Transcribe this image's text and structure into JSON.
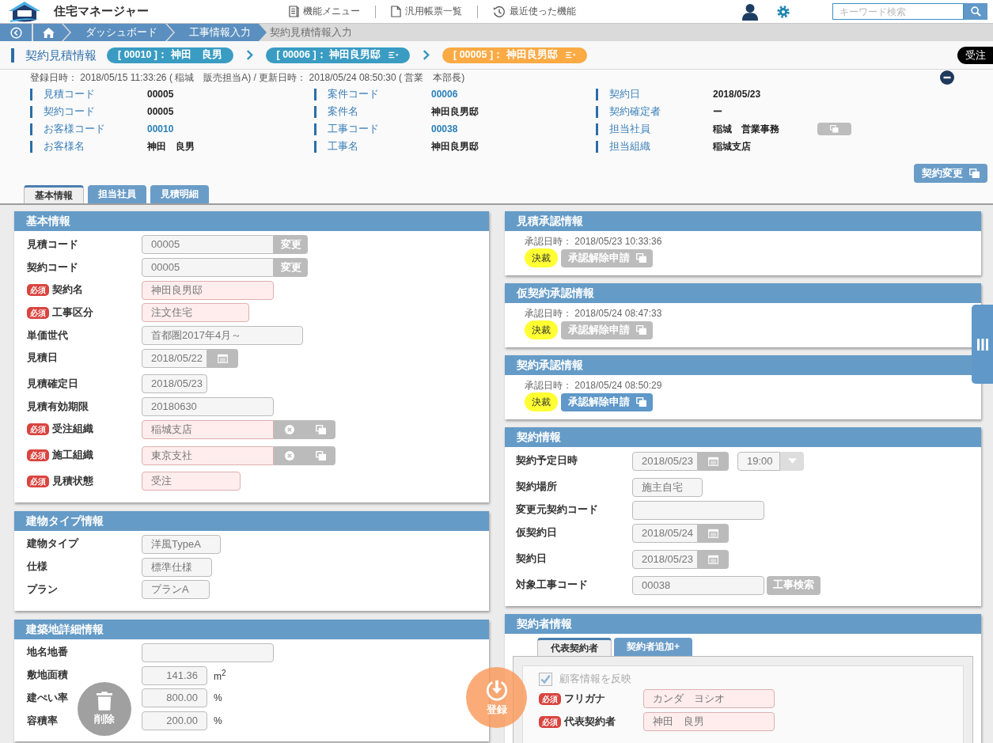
{
  "header": {
    "app_title": "住宅マネージャー",
    "menu": [
      {
        "kind": "functions",
        "label": "機能メニュー"
      },
      {
        "kind": "forms",
        "label": "汎用帳票一覧"
      },
      {
        "kind": "recent",
        "label": "最近使った機能"
      }
    ],
    "search": {
      "placeholder": "キーワード検索"
    }
  },
  "breadcrumb": [
    {
      "kind": "back"
    },
    {
      "kind": "home"
    },
    {
      "kind": "link",
      "label": "ダッシュボード"
    },
    {
      "kind": "link",
      "label": "工事情報入力"
    },
    {
      "kind": "current",
      "label": "契約見積情報入力"
    }
  ],
  "title_bar": {
    "title": "契約見積情報",
    "chips": [
      {
        "label": "[ 00010 ]： 神田　良男",
        "color": "#3a9cc2",
        "menu": false
      },
      {
        "label": "[ 00006 ]： 神田良男邸",
        "color": "#3a9cc2",
        "menu": true
      },
      {
        "label": "[ 00005 ]： 神田良男邸",
        "color": "#fbaa44",
        "menu": true
      }
    ],
    "status_badge": "受注"
  },
  "record_info": {
    "timestamps": "登録日時： 2018/05/15 11:33:26 ( 稲城　販売担当A) / 更新日時： 2018/05/24 08:50:30 ( 営業　本部長)",
    "expanded": true,
    "columns": [
      [
        {
          "label": "見積コード",
          "value": "00005",
          "kind": "text"
        },
        {
          "label": "契約コード",
          "value": "00005",
          "kind": "text"
        },
        {
          "label": "お客様コード",
          "value": "00010",
          "kind": "link"
        },
        {
          "label": "お客様名",
          "value": "神田　良男",
          "kind": "text"
        }
      ],
      [
        {
          "label": "案件コード",
          "value": "00006",
          "kind": "link"
        },
        {
          "label": "案件名",
          "value": "神田良男邸",
          "kind": "text"
        },
        {
          "label": "工事コード",
          "value": "00038",
          "kind": "link"
        },
        {
          "label": "工事名",
          "value": "神田良男邸",
          "kind": "text"
        }
      ],
      [
        {
          "label": "契約日",
          "value": "2018/05/23",
          "kind": "text"
        },
        {
          "label": "契約確定者",
          "value": "ー",
          "kind": "text"
        },
        {
          "label": "担当社員",
          "value": "稲城　営業事務",
          "kind": "text_button"
        },
        {
          "label": "担当組織",
          "value": "稲城支店",
          "kind": "text"
        }
      ]
    ],
    "action_button": "契約変更"
  },
  "tabs": [
    {
      "label": "基本情報",
      "selected": true
    },
    {
      "label": "担当社員",
      "selected": false
    },
    {
      "label": "見積明細",
      "selected": false
    }
  ],
  "basic_panels": [
    {
      "title": "基本情報",
      "rows": [
        {
          "label": "見積コード",
          "required": false,
          "kind": "field_button",
          "value": "00005",
          "button": "変更"
        },
        {
          "label": "契約コード",
          "required": false,
          "kind": "field_button",
          "value": "00005",
          "button": "変更"
        },
        {
          "label": "契約名",
          "required": true,
          "badge": "必須",
          "kind": "field",
          "value": "神田良男邸"
        },
        {
          "label": "工事区分",
          "required": true,
          "badge": "必須",
          "kind": "field",
          "value": "注文住宅"
        },
        {
          "label": "単価世代",
          "required": false,
          "kind": "field",
          "value": "首都圏2017年4月～"
        },
        {
          "label": "見積日",
          "required": false,
          "kind": "date",
          "value": "2018/05/22"
        },
        {
          "label": "見積確定日",
          "required": false,
          "kind": "field",
          "value": "2018/05/23"
        },
        {
          "label": "見積有効期限",
          "required": false,
          "kind": "field",
          "value": "20180630"
        },
        {
          "label": "受注組織",
          "required": true,
          "badge": "必須",
          "kind": "org",
          "value": "稲城支店"
        },
        {
          "label": "施工組織",
          "required": true,
          "badge": "必須",
          "kind": "org",
          "value": "東京支社"
        },
        {
          "label": "見積状態",
          "required": true,
          "badge": "必須",
          "kind": "field",
          "value": "受注"
        }
      ]
    },
    {
      "title": "建物タイプ情報",
      "rows": [
        {
          "label": "建物タイプ",
          "required": false,
          "kind": "field",
          "value": "洋風TypeA"
        },
        {
          "label": "仕様",
          "required": false,
          "kind": "field",
          "value": "標準仕様"
        },
        {
          "label": "プラン",
          "required": false,
          "kind": "field",
          "value": "プランA"
        }
      ]
    },
    {
      "title": "建築地詳細情報",
      "rows": [
        {
          "label": "地名地番",
          "required": false,
          "kind": "field"
        },
        {
          "label": "敷地面積",
          "required": false,
          "kind": "unit",
          "value": "141.36",
          "unit": "m$^{2}$"
        },
        {
          "label": "建ぺい率",
          "required": false,
          "kind": "unit",
          "value": "800.00",
          "unit": "%"
        },
        {
          "label": "容積率",
          "required": false,
          "kind": "unit",
          "value": "200.00",
          "unit": "%"
        }
      ]
    }
  ],
  "approval_panels": [
    {
      "title": "見積承認情報",
      "approved_at": "承認日時： 2018/05/23 10:33:36",
      "status": "決裁",
      "button": {
        "label": "承認解除申請",
        "disabled": true
      }
    },
    {
      "title": "仮契約承認情報",
      "approved_at": "承認日時： 2018/05/24 08:47:33",
      "status": "決裁",
      "button": {
        "label": "承認解除申請",
        "disabled": true
      }
    },
    {
      "title": "契約承認情報",
      "approved_at": "承認日時： 2018/05/24 08:50:29",
      "status": "決裁",
      "button": {
        "label": "承認解除申請",
        "disabled": false
      }
    }
  ],
  "contract_panel": {
    "title": "契約情報",
    "rows": [
      {
        "label": "契約予定日時",
        "kind": "date_time",
        "value": "2018/05/23",
        "time": "19:00"
      },
      {
        "label": "契約場所",
        "kind": "field",
        "value": "施主自宅"
      },
      {
        "label": "変更元契約コード",
        "kind": "field"
      },
      {
        "label": "仮契約日",
        "kind": "date",
        "value": "2018/05/24"
      },
      {
        "label": "契約日",
        "kind": "date",
        "value": "2018/05/23"
      },
      {
        "label": "対象工事コード",
        "kind": "field_button",
        "value": "00038",
        "button": "工事検索"
      }
    ]
  },
  "contractor_panel": {
    "title": "契約者情報",
    "tabs": [
      {
        "label": "代表契約者",
        "selected": true
      },
      {
        "label": "契約者追加+",
        "selected": false
      }
    ],
    "reflect_customer": {
      "label": "顧客情報を反映",
      "checked": true,
      "disabled": true
    },
    "rows": [
      {
        "label": "フリガナ",
        "required": true,
        "badge": "必須",
        "value": "カンダ　ヨシオ"
      },
      {
        "label": "代表契約者",
        "required": true,
        "badge": "必須",
        "value": "神田　良男"
      }
    ]
  },
  "floating_actions": [
    {
      "kind": "delete",
      "label": "削除"
    },
    {
      "kind": "save",
      "label": "登録"
    }
  ]
}
